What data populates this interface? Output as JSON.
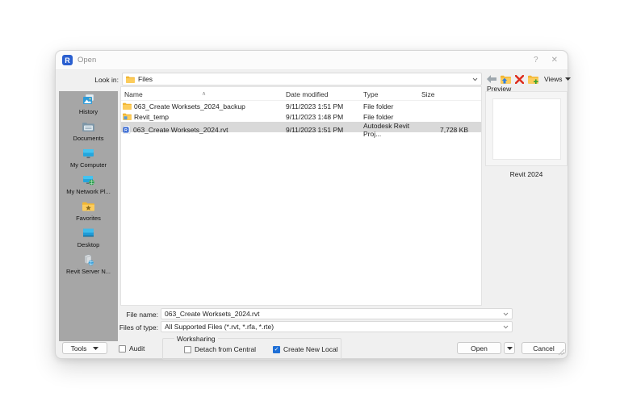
{
  "window": {
    "title": "Open",
    "help_glyph": "?",
    "close_glyph": "✕"
  },
  "look_in": {
    "label": "Look in:",
    "value": "Files"
  },
  "toolbar": {
    "views_label": "Views"
  },
  "sidebar": {
    "items": [
      {
        "label": "History"
      },
      {
        "label": "Documents"
      },
      {
        "label": "My Computer"
      },
      {
        "label": "My Network Pl..."
      },
      {
        "label": "Favorites"
      },
      {
        "label": "Desktop"
      },
      {
        "label": "Revit Server N..."
      }
    ]
  },
  "file_list": {
    "columns": [
      "Name",
      "Date modified",
      "Type",
      "Size"
    ],
    "sort_indicator": "∧",
    "rows": [
      {
        "name": "063_Create Worksets_2024_backup",
        "date": "9/11/2023 1:51 PM",
        "type": "File folder",
        "size": "",
        "selected": false
      },
      {
        "name": "Revit_temp",
        "date": "9/11/2023 1:48 PM",
        "type": "File folder",
        "size": "",
        "selected": false
      },
      {
        "name": "063_Create Worksets_2024.rvt",
        "date": "9/11/2023 1:51 PM",
        "type": "Autodesk Revit Proj...",
        "size": "7,728 KB",
        "selected": true
      }
    ]
  },
  "preview": {
    "label": "Preview",
    "caption": "Revit 2024"
  },
  "file_name": {
    "label": "File name:",
    "value": "063_Create Worksets_2024.rvt"
  },
  "files_of_type": {
    "label": "Files of type:",
    "value": "All Supported Files  (*.rvt, *.rfa, *.rte)"
  },
  "footer": {
    "tools_label": "Tools",
    "audit_label": "Audit",
    "audit_checked": false,
    "worksharing": {
      "label": "Worksharing",
      "detach_label": "Detach from Central",
      "detach_checked": false,
      "create_label": "Create New Local",
      "create_checked": true
    },
    "open_label": "Open",
    "cancel_label": "Cancel"
  },
  "colors": {
    "accent_blue": "#1f6fd6",
    "selection_gray": "#d9d9d9",
    "sidebar_gray": "#a6a6a6",
    "delete_red": "#dd2b1c",
    "folder_yellow": "#f2b632"
  }
}
